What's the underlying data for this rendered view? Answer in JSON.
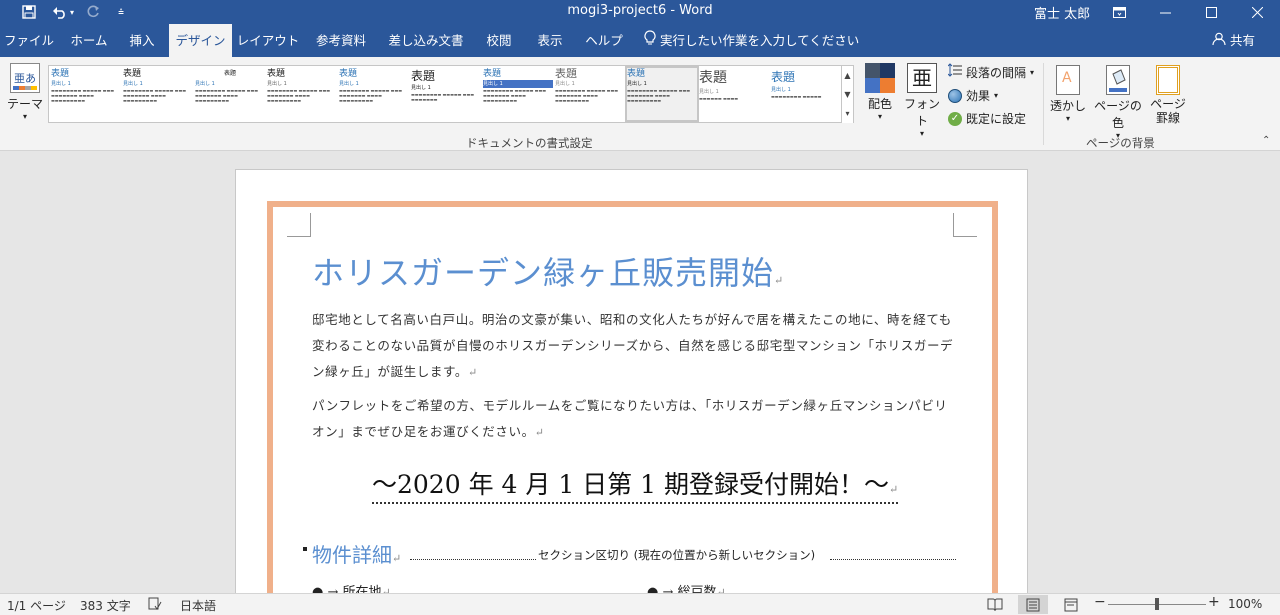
{
  "titlebar": {
    "title": "mogi3-project6  -  Word",
    "user": "富士 太郎",
    "save_icon": "save-icon",
    "undo_icon": "undo-icon",
    "redo_icon": "redo-icon"
  },
  "tabs": {
    "items": [
      "ファイル",
      "ホーム",
      "挿入",
      "デザイン",
      "レイアウト",
      "参考資料",
      "差し込み文書",
      "校閲",
      "表示",
      "ヘルプ"
    ],
    "active": "デザイン",
    "tell_me": "実行したい作業を入力してください",
    "share": "共有"
  },
  "ribbon": {
    "theme_label": "テーマ",
    "gallery_items": [
      {
        "title": "表題",
        "heading": "見出し 1"
      },
      {
        "title": "表題",
        "heading": "見出し 1"
      },
      {
        "title": "表題",
        "heading": "見出し 1"
      },
      {
        "title": "表題",
        "heading": "見出し 1"
      },
      {
        "title": "表題",
        "heading": "見出し 1"
      },
      {
        "title": "表題",
        "heading": "見出し 1"
      },
      {
        "title": "表題",
        "heading": "見出し 1"
      },
      {
        "title": "表題",
        "heading": "見出し 1"
      },
      {
        "title": "表題",
        "heading": "見出し 1"
      },
      {
        "title": "表題",
        "heading": "見出し 1"
      },
      {
        "title": "表題",
        "heading": "見出し 1"
      }
    ],
    "colors_label": "配色",
    "font_label": "フォント",
    "font_glyph": "亜",
    "paragraph_spacing": "段落の間隔",
    "effects": "効果",
    "set_default": "既定に設定",
    "group_document_format": "ドキュメントの書式設定",
    "watermark": "透かし",
    "page_color": "ページの色",
    "page_border_line1": "ページ",
    "page_border_line2": "罫線",
    "group_page_background": "ページの背景"
  },
  "document": {
    "heading": "ホリスガーデン緑ヶ丘販売開始",
    "paragraph1": "邸宅地として名高い白戸山。明治の文豪が集い、昭和の文化人たちが好んで居を構えたこの地に、時を経ても変わることのない品質が自慢のホリスガーデンシリーズから、自然を感じる邸宅型マンション「ホリスガーデン緑ヶ丘」が誕生します。",
    "paragraph2": "パンフレットをご希望の方、モデルルームをご覧になりたい方は、「ホリスガーデン緑ヶ丘マンションパビリオン」までぜひ足をお運びください。",
    "banner": "～2020 年 4 月 1 日第 1 期登録受付開始！～",
    "section_heading": "物件詳細",
    "section_break": "セクション区切り (現在の位置から新しいセクション)",
    "bullet1": "所在地",
    "bullet2": "総戸数",
    "para_mark": "↵"
  },
  "status": {
    "page": "1/1 ページ",
    "words": "383 文字",
    "language": "日本語",
    "zoom": "100%",
    "zoom_level_percent": 100
  },
  "colors": {
    "accent": "#2b579a",
    "heading": "#5b8fd0",
    "page_border": "#f0b08a"
  }
}
